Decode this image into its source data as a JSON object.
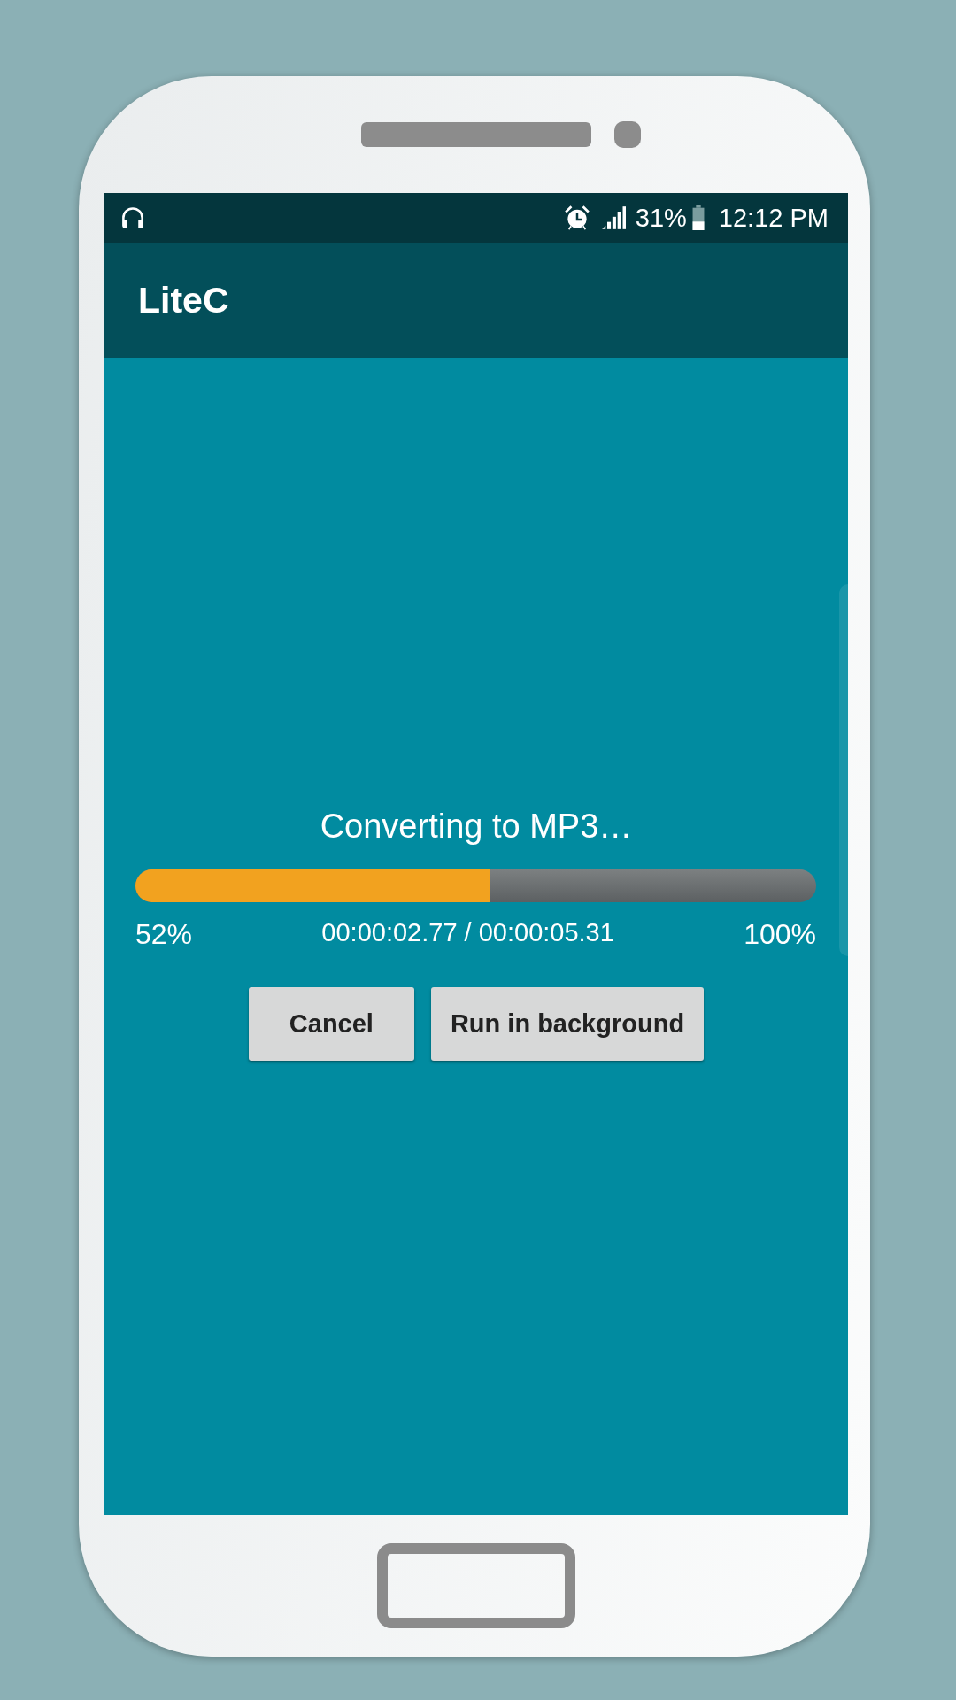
{
  "status_bar": {
    "battery_text": "31%",
    "time": "12:12 PM"
  },
  "app_bar": {
    "title": "LiteC"
  },
  "dialog": {
    "message": "Converting to MP3…",
    "progress": {
      "level": 0.52,
      "start_label": "52%",
      "time_label": "00:00:02.77 / 00:00:05.31",
      "end_label": "100%"
    },
    "buttons": [
      {
        "label": "Cancel"
      },
      {
        "label": "Run in background"
      }
    ]
  }
}
